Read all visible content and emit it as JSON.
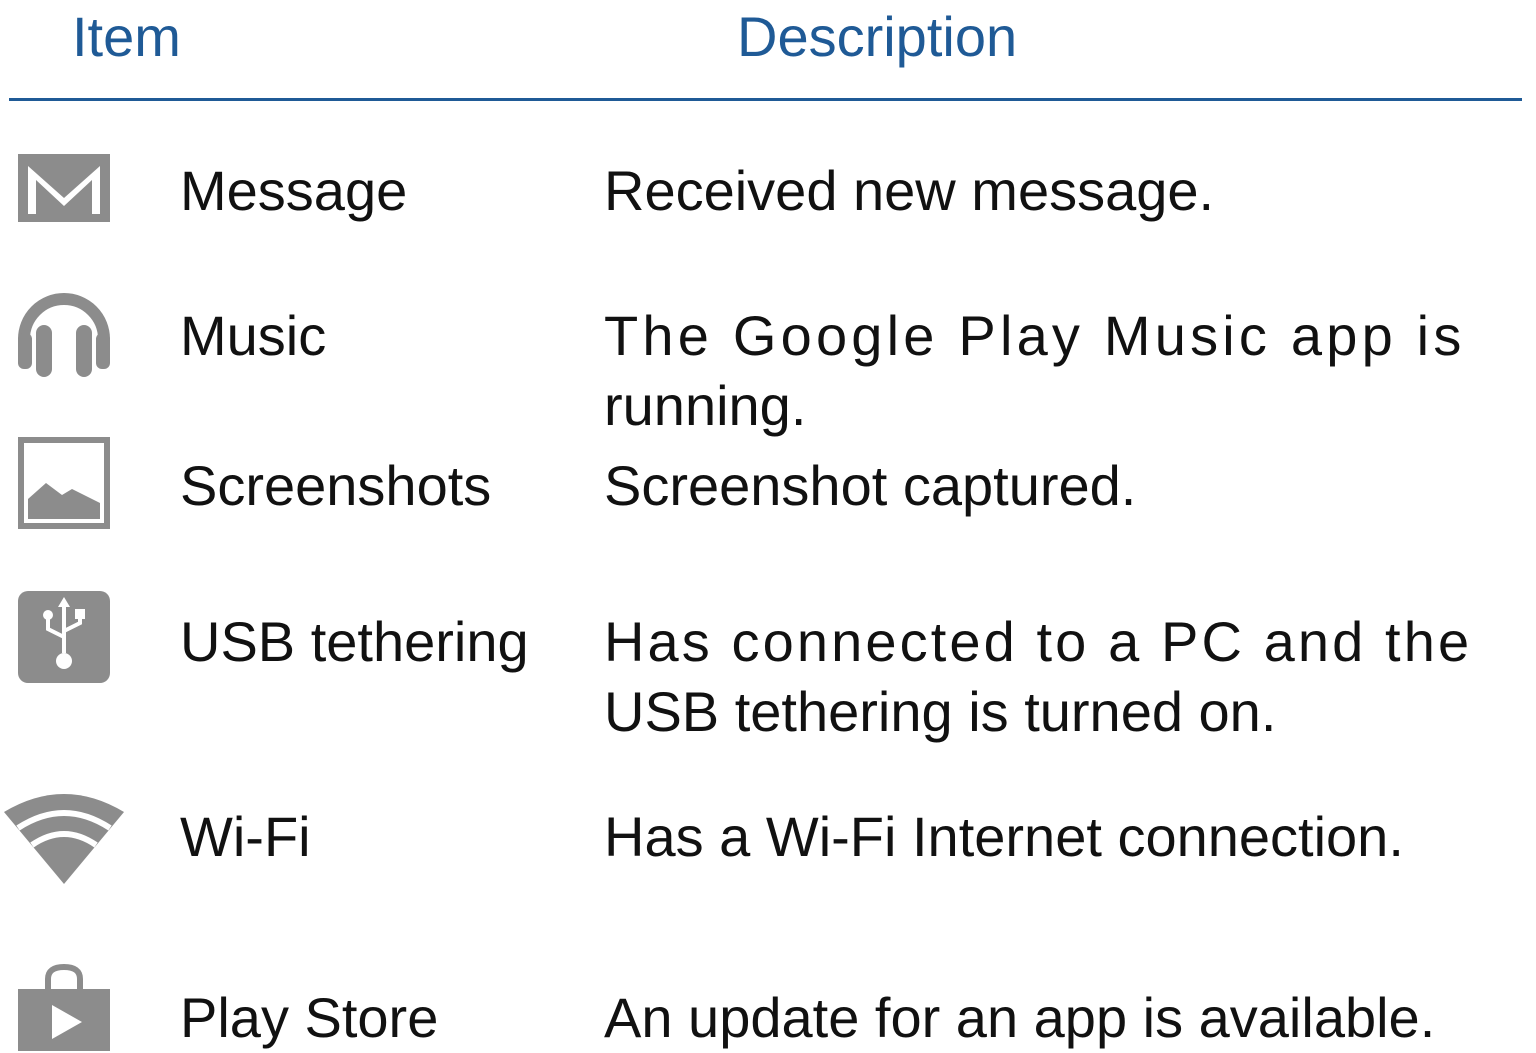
{
  "header": {
    "item": "Item",
    "description": "Description"
  },
  "colors": {
    "header_text": "#1f5a96",
    "rule": "#1f5a96",
    "icon_gray": "#8c8c8c",
    "body_text": "#111111"
  },
  "rows": [
    {
      "icon": "mail-icon",
      "label": "Message",
      "desc_lines": [
        "Received new message."
      ]
    },
    {
      "icon": "headphones-icon",
      "label": "Music",
      "desc_lines": [
        "The Google Play Music app is",
        "running."
      ]
    },
    {
      "icon": "image-icon",
      "label": "Screenshots",
      "desc_lines": [
        "Screenshot captured."
      ]
    },
    {
      "icon": "usb-icon",
      "label": "USB tethering",
      "desc_lines": [
        "Has connected to a PC and the",
        "USB tethering is turned on."
      ]
    },
    {
      "icon": "wifi-icon",
      "label": "Wi-Fi",
      "desc_lines": [
        "Has a Wi-Fi Internet connection."
      ]
    },
    {
      "icon": "play-store-icon",
      "label": "Play Store",
      "desc_lines": [
        "An update for an app is available."
      ]
    }
  ]
}
